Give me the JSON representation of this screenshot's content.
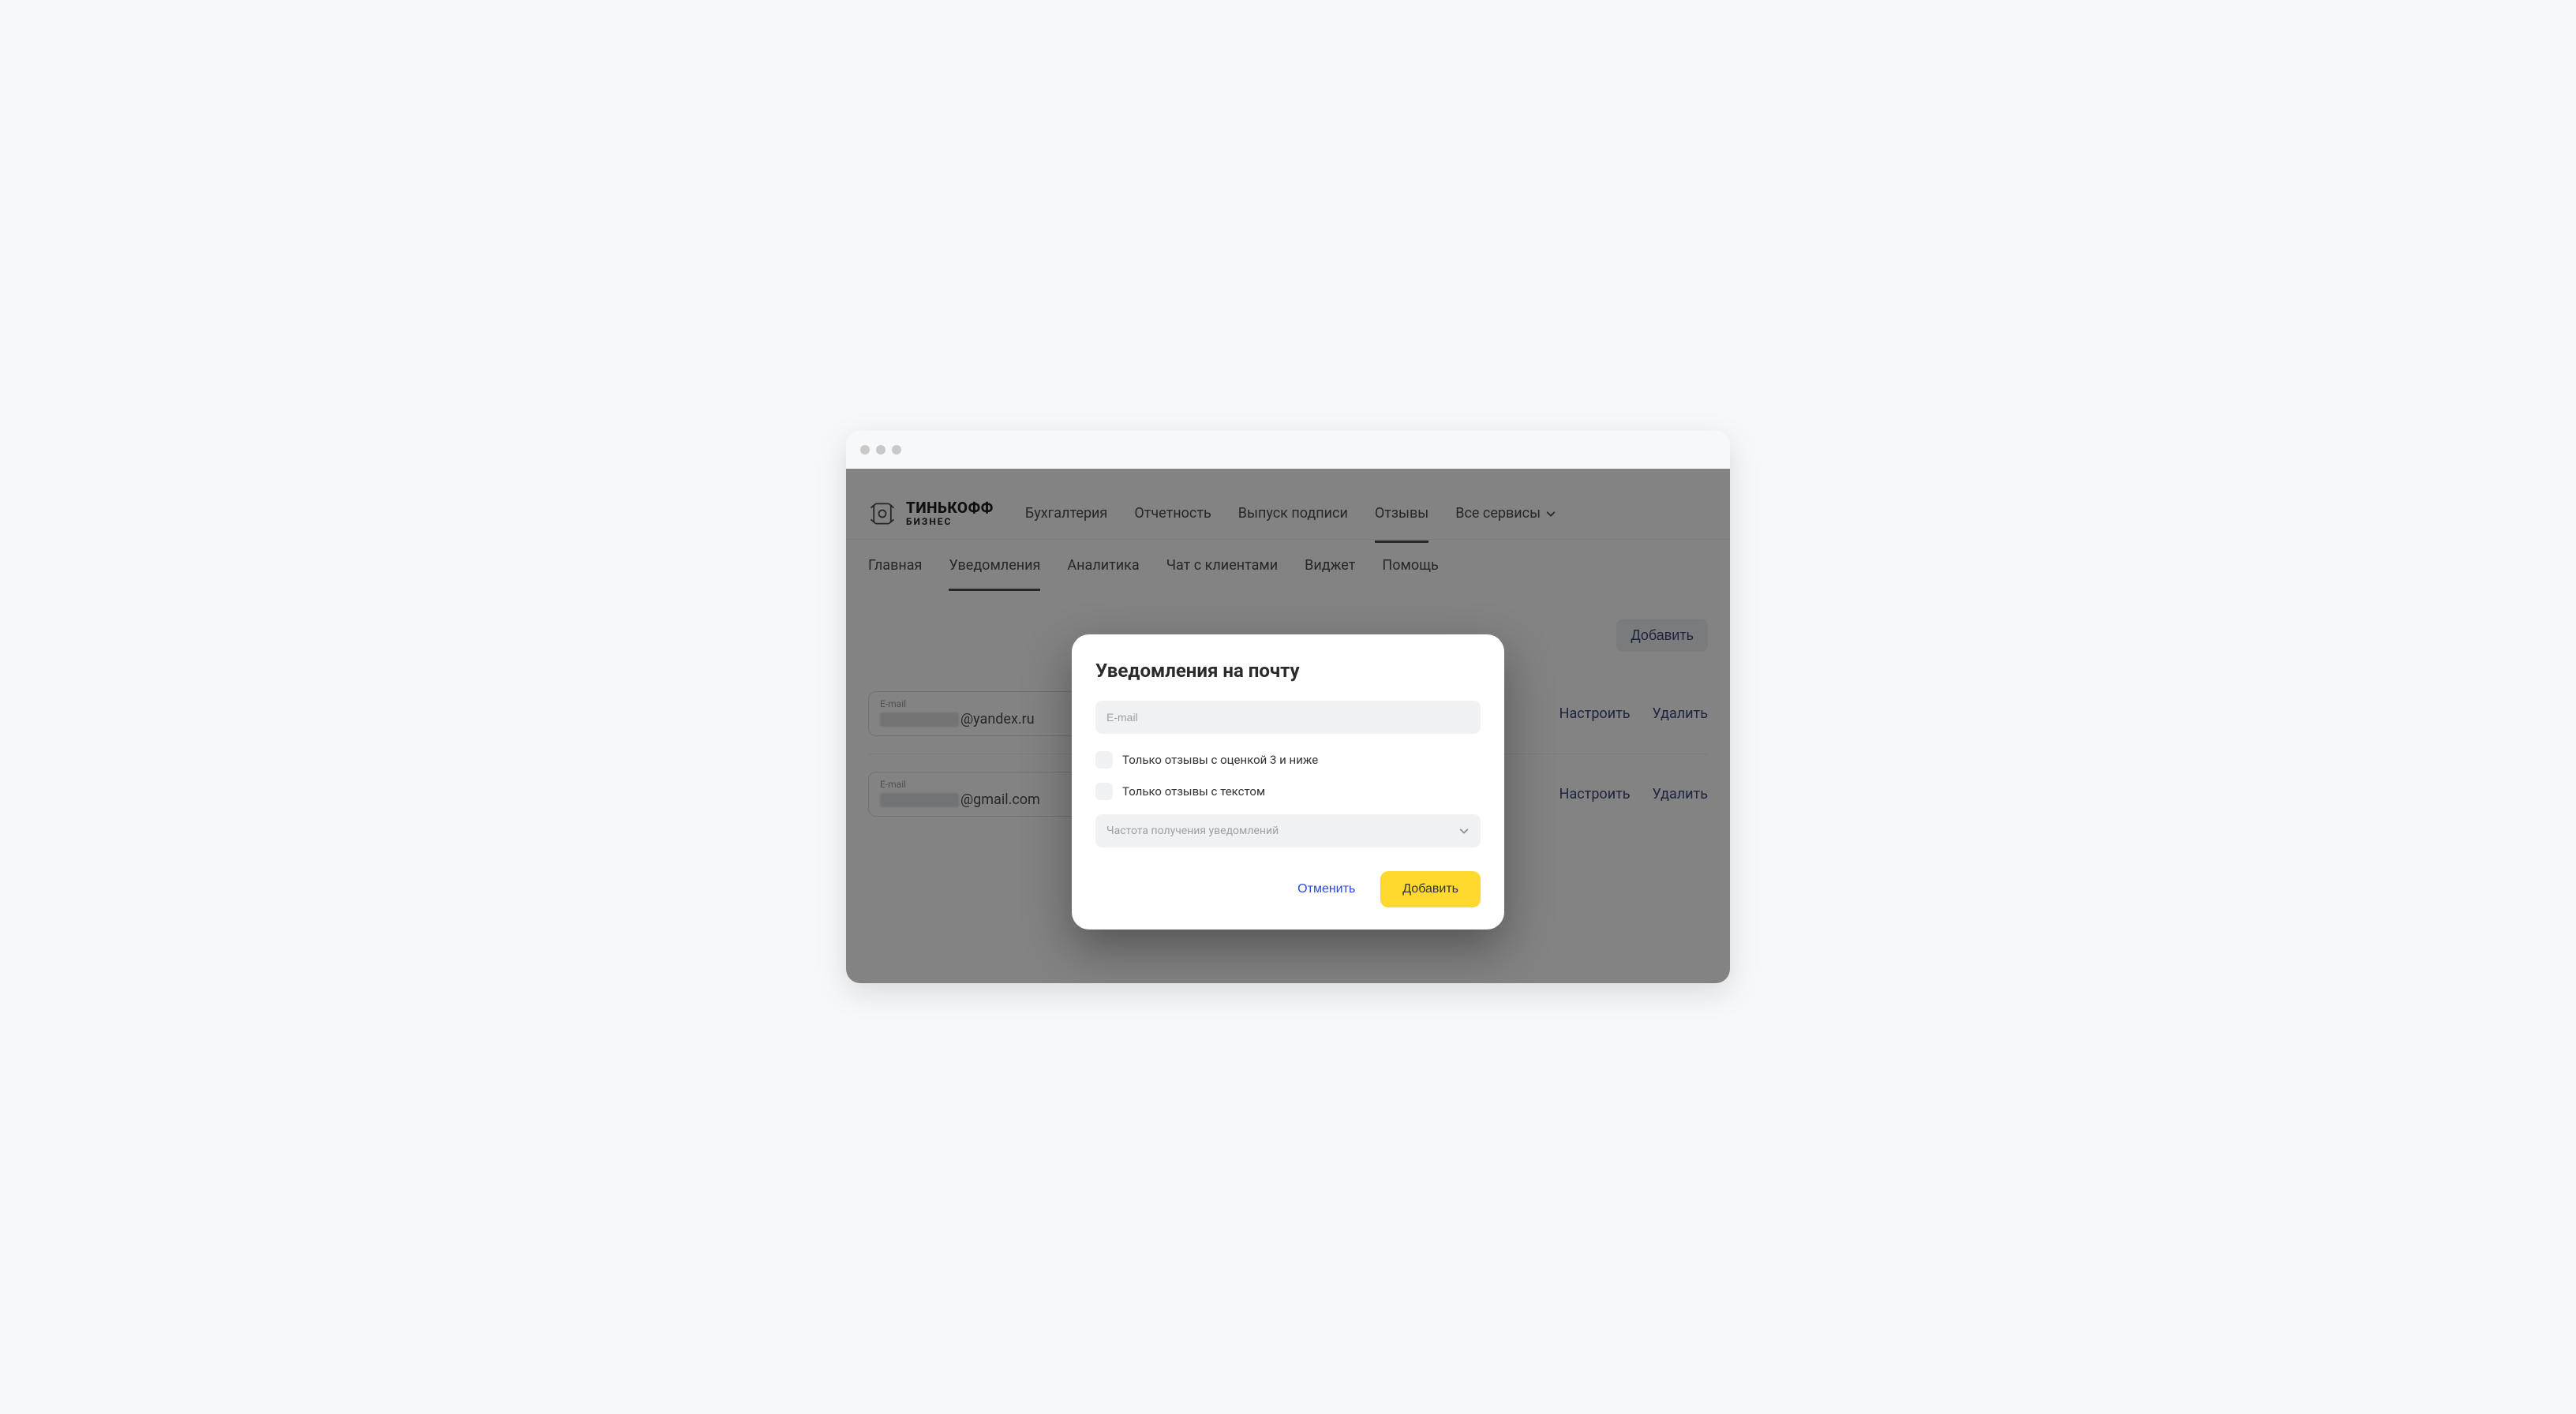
{
  "brand": {
    "line1": "ТИНЬКОФФ",
    "line2": "БИЗНЕС"
  },
  "main_nav": {
    "items": [
      {
        "label": "Бухгалтерия"
      },
      {
        "label": "Отчетность"
      },
      {
        "label": "Выпуск подписи"
      },
      {
        "label": "Отзывы"
      },
      {
        "label": "Все сервисы"
      }
    ],
    "active_index": 3
  },
  "sub_nav": {
    "items": [
      {
        "label": "Главная"
      },
      {
        "label": "Уведомления"
      },
      {
        "label": "Аналитика"
      },
      {
        "label": "Чат с клиентами"
      },
      {
        "label": "Виджет"
      },
      {
        "label": "Помощь"
      }
    ],
    "active_index": 1
  },
  "page": {
    "add_button": "Добавить",
    "email_rows": [
      {
        "field_label": "E-mail",
        "domain": "@yandex.ru",
        "configure": "Настроить",
        "delete": "Удалить"
      },
      {
        "field_label": "E-mail",
        "domain": "@gmail.com",
        "configure": "Настроить",
        "delete": "Удалить"
      }
    ]
  },
  "modal": {
    "title": "Уведомления на почту",
    "email_placeholder": "E-mail",
    "checkbox1": "Только отзывы с оценкой 3 и ниже",
    "checkbox2": "Только отзывы с текстом",
    "frequency_placeholder": "Частота получения уведомлений",
    "cancel": "Отменить",
    "submit": "Добавить"
  }
}
